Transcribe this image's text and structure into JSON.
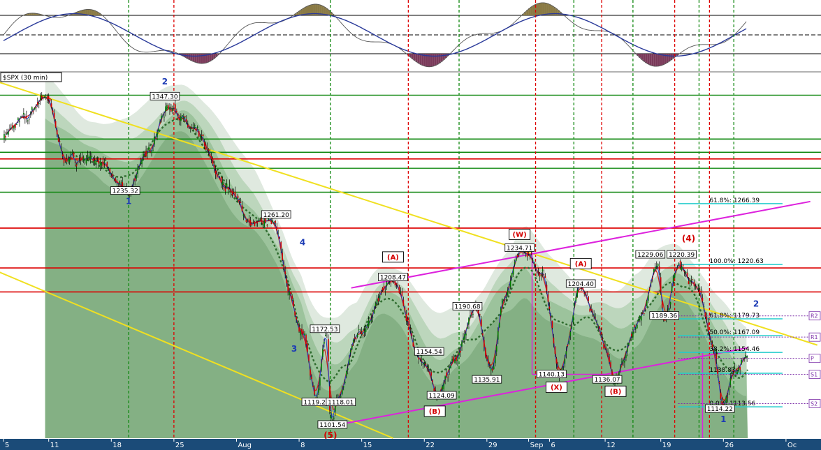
{
  "chart_data": {
    "type": "line",
    "title": "$SPX (30 min)",
    "ylim": [
      1090,
      1365
    ],
    "x_tick_labels": [
      {
        "label": "5",
        "bar": 0
      },
      {
        "label": "11",
        "bar": 65
      },
      {
        "label": "18",
        "bar": 155
      },
      {
        "label": "25",
        "bar": 245
      },
      {
        "label": "Aug",
        "bar": 335
      },
      {
        "label": "8",
        "bar": 425
      },
      {
        "label": "15",
        "bar": 515
      },
      {
        "label": "22",
        "bar": 605
      },
      {
        "label": "29",
        "bar": 695
      },
      {
        "label": "Sep",
        "bar": 755
      },
      {
        "label": "6",
        "bar": 785
      },
      {
        "label": "12",
        "bar": 865
      },
      {
        "label": "19",
        "bar": 945
      },
      {
        "label": "26",
        "bar": 1035
      },
      {
        "label": "Oc",
        "bar": 1125
      }
    ],
    "price_pivots": [
      {
        "bar": 0,
        "price": 1318
      },
      {
        "bar": 30,
        "price": 1330
      },
      {
        "bar": 60,
        "price": 1348
      },
      {
        "bar": 90,
        "price": 1300
      },
      {
        "bar": 130,
        "price": 1300
      },
      {
        "bar": 180,
        "price": 1275
      },
      {
        "bar": 200,
        "price": 1300
      },
      {
        "bar": 240,
        "price": 1340
      },
      {
        "bar": 275,
        "price": 1320
      },
      {
        "bar": 320,
        "price": 1280
      },
      {
        "bar": 360,
        "price": 1250
      },
      {
        "bar": 390,
        "price": 1255
      },
      {
        "bar": 410,
        "price": 1200
      },
      {
        "bar": 430,
        "price": 1170
      },
      {
        "bar": 450,
        "price": 1119
      },
      {
        "bar": 465,
        "price": 1170
      },
      {
        "bar": 470,
        "price": 1102
      },
      {
        "bar": 480,
        "price": 1118
      },
      {
        "bar": 510,
        "price": 1170
      },
      {
        "bar": 560,
        "price": 1208
      },
      {
        "bar": 600,
        "price": 1150
      },
      {
        "bar": 625,
        "price": 1124
      },
      {
        "bar": 650,
        "price": 1150
      },
      {
        "bar": 680,
        "price": 1190
      },
      {
        "bar": 700,
        "price": 1140
      },
      {
        "bar": 720,
        "price": 1195
      },
      {
        "bar": 745,
        "price": 1231
      },
      {
        "bar": 775,
        "price": 1215
      },
      {
        "bar": 800,
        "price": 1140
      },
      {
        "bar": 830,
        "price": 1205
      },
      {
        "bar": 850,
        "price": 1180
      },
      {
        "bar": 880,
        "price": 1136
      },
      {
        "bar": 915,
        "price": 1180
      },
      {
        "bar": 940,
        "price": 1220
      },
      {
        "bar": 950,
        "price": 1180
      },
      {
        "bar": 970,
        "price": 1220
      },
      {
        "bar": 1000,
        "price": 1200
      },
      {
        "bar": 1020,
        "price": 1160
      },
      {
        "bar": 1035,
        "price": 1114
      },
      {
        "bar": 1050,
        "price": 1140
      },
      {
        "bar": 1070,
        "price": 1150
      }
    ],
    "price_labels": [
      {
        "text": "1347.30",
        "bar": 232,
        "price": 1347
      },
      {
        "text": "1235.32",
        "bar": 175,
        "price": 1276
      },
      {
        "text": "1261.20",
        "bar": 392,
        "price": 1258
      },
      {
        "text": "1208.47",
        "bar": 560,
        "price": 1211
      },
      {
        "text": "1190.68",
        "bar": 667,
        "price": 1189
      },
      {
        "text": "1172.53",
        "bar": 462,
        "price": 1172
      },
      {
        "text": "1154.54",
        "bar": 612,
        "price": 1155
      },
      {
        "text": "1119.28",
        "bar": 450,
        "price": 1117
      },
      {
        "text": "1118.01",
        "bar": 485,
        "price": 1117
      },
      {
        "text": "1101.54",
        "bar": 473,
        "price": 1100
      },
      {
        "text": "1135.91",
        "bar": 695,
        "price": 1134
      },
      {
        "text": "1124.09",
        "bar": 630,
        "price": 1122
      },
      {
        "text": "1234.71",
        "bar": 742,
        "price": 1233
      },
      {
        "text": "1204.40",
        "bar": 830,
        "price": 1206
      },
      {
        "text": "1140.13",
        "bar": 788,
        "price": 1138
      },
      {
        "text": "1136.07",
        "bar": 868,
        "price": 1134
      },
      {
        "text": "1229.06",
        "bar": 930,
        "price": 1228
      },
      {
        "text": "1220.39",
        "bar": 975,
        "price": 1228
      },
      {
        "text": "1189.36",
        "bar": 950,
        "price": 1182
      },
      {
        "text": "1114.22",
        "bar": 1030,
        "price": 1112
      }
    ],
    "wave_labels": [
      {
        "text": "2",
        "bar": 232,
        "price": 1356,
        "color": "#1c3bb5"
      },
      {
        "text": "1",
        "bar": 180,
        "price": 1266,
        "color": "#1c3bb5"
      },
      {
        "text": "4",
        "bar": 430,
        "price": 1235,
        "color": "#1c3bb5"
      },
      {
        "text": "3",
        "bar": 418,
        "price": 1155,
        "color": "#1c3bb5"
      },
      {
        "text": "1",
        "bar": 1035,
        "price": 1102,
        "color": "#1c3bb5"
      },
      {
        "text": "2",
        "bar": 1082,
        "price": 1189,
        "color": "#1c3bb5"
      },
      {
        "text": "(4)",
        "bar": 985,
        "price": 1238,
        "color": "#d40000"
      },
      {
        "text": "(5)",
        "bar": 470,
        "price": 1090,
        "color": "#d40000"
      }
    ],
    "boxed_wave_labels": [
      {
        "text": "(W)",
        "bar": 742,
        "price": 1243
      },
      {
        "text": "(A)",
        "bar": 560,
        "price": 1226
      },
      {
        "text": "(A)",
        "bar": 830,
        "price": 1221
      },
      {
        "text": "(X)",
        "bar": 795,
        "price": 1128
      },
      {
        "text": "(B)",
        "bar": 620,
        "price": 1110
      },
      {
        "text": "(B)",
        "bar": 880,
        "price": 1125
      }
    ],
    "fibonacci_levels": [
      {
        "label": "61.8%: 1266.39",
        "price": 1266.39
      },
      {
        "label": "100.0%: 1220.63",
        "price": 1220.63
      },
      {
        "label": "61.8%: 1179.73",
        "price": 1179.73
      },
      {
        "label": "50.0%: 1167.09",
        "price": 1167.09
      },
      {
        "label": "38.2%: 1154.46",
        "price": 1154.46
      },
      {
        "label": "1138.83",
        "price": 1138.83
      },
      {
        "label": "0.0%: 1113.56",
        "price": 1113.56
      }
    ],
    "pivot_labels": [
      {
        "text": "R2",
        "price": 1182
      },
      {
        "text": "R1",
        "price": 1166
      },
      {
        "text": "P",
        "price": 1150
      },
      {
        "text": "S1",
        "price": 1138
      },
      {
        "text": "S2",
        "price": 1116
      }
    ],
    "grid": false,
    "colors": {
      "resistance": "#dd0000",
      "support": "#118811",
      "trendline_yellow": "#f0e020",
      "channel_magenta": "#dd22dd",
      "fib_cyan": "#22cccc",
      "candle_up": "#007700",
      "candle_down": "#cc0000",
      "moving_avg_red": "#cc2222",
      "moving_avg_blue": "#2244cc",
      "moving_avg_dotted": "#2e6b2e",
      "axis_background": "#1b4b78",
      "oscillator_up": "#8a7a45",
      "oscillator_down": "#7a3a5a",
      "oscillator_line": "#2a3a9a"
    }
  }
}
